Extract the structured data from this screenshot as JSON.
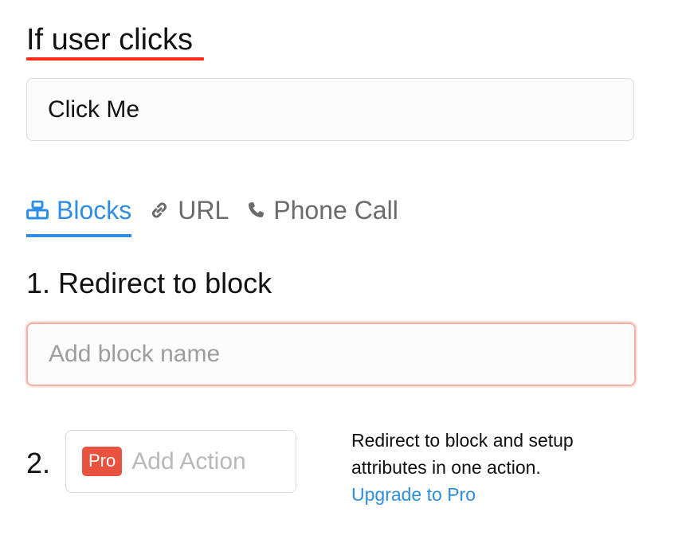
{
  "trigger": {
    "title": "If user clicks",
    "button_text_value": "Click Me"
  },
  "tabs": [
    {
      "label": "Blocks",
      "icon": "blocks-icon",
      "active": true
    },
    {
      "label": "URL",
      "icon": "link-icon",
      "active": false
    },
    {
      "label": "Phone Call",
      "icon": "phone-icon",
      "active": false
    }
  ],
  "step1": {
    "title": "1. Redirect to block",
    "input_placeholder": "Add block name"
  },
  "step2": {
    "number": "2.",
    "badge": "Pro",
    "action_label": "Add Action",
    "note_text": "Redirect to block and setup attributes in one action.",
    "link_text": "Upgrade to Pro"
  },
  "colors": {
    "accent_blue": "#2d8ee6",
    "underline_red": "#ff2a1a",
    "pro_badge": "#e9523f",
    "error_border": "#f4b2a6"
  }
}
